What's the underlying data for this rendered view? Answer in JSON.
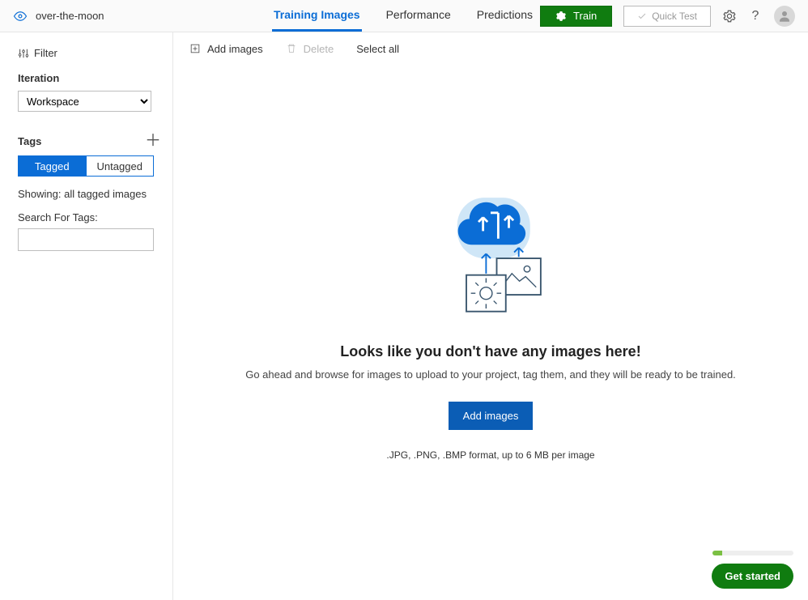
{
  "header": {
    "project_name": "over-the-moon",
    "tabs": {
      "training": "Training Images",
      "performance": "Performance",
      "predictions": "Predictions"
    },
    "train_label": "Train",
    "quick_test_label": "Quick Test"
  },
  "sidebar": {
    "filter_label": "Filter",
    "iteration_label": "Iteration",
    "iteration_value": "Workspace",
    "tags_label": "Tags",
    "tagged_label": "Tagged",
    "untagged_label": "Untagged",
    "showing_text": "Showing: all tagged images",
    "search_label": "Search For Tags:"
  },
  "actionbar": {
    "add_images": "Add images",
    "delete": "Delete",
    "select_all": "Select all"
  },
  "empty": {
    "title": "Looks like you don't have any images here!",
    "subtitle": "Go ahead and browse for images to upload to your project, tag them, and they will be ready to be trained.",
    "add_button": "Add images",
    "hint": ".JPG, .PNG, .BMP format, up to 6 MB per image"
  },
  "footer": {
    "get_started": "Get started"
  }
}
